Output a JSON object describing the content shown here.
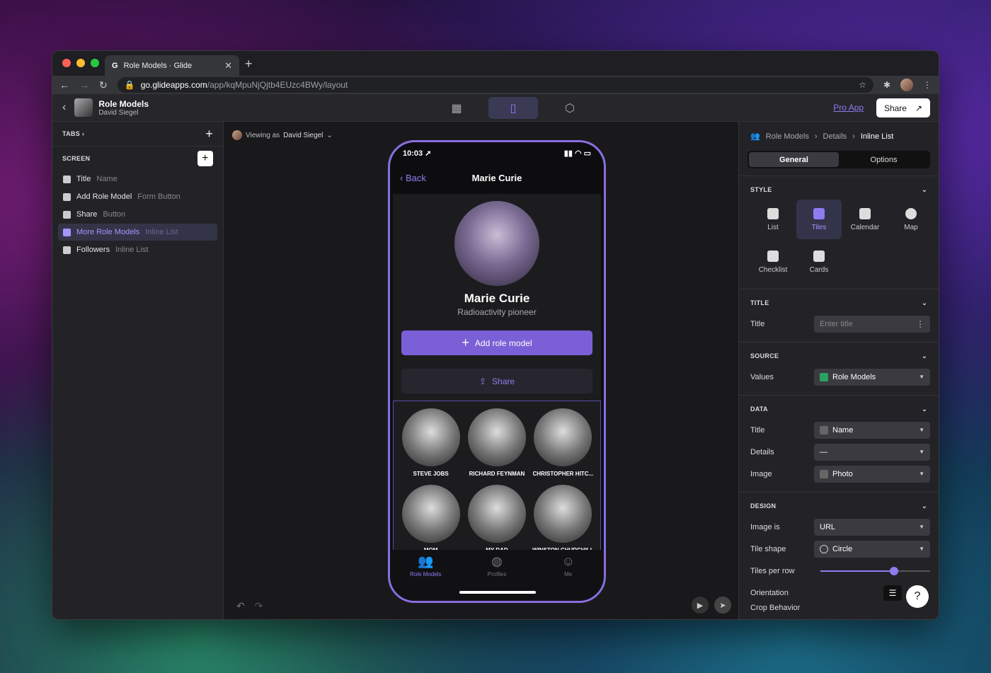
{
  "browser": {
    "tab_favicon": "G",
    "tab_title": "Role Models · Glide",
    "url_host": "go.glideapps.com",
    "url_path": "/app/kqMpuNjQjtb4EUzc4BWy/layout"
  },
  "header": {
    "app_title": "Role Models",
    "app_subtitle": "David Siegel",
    "pro_app": "Pro App",
    "share": "Share"
  },
  "left": {
    "tabs_label": "TABS",
    "screen_label": "SCREEN",
    "components": [
      {
        "name": "Title",
        "type": "Name"
      },
      {
        "name": "Add Role Model",
        "type": "Form Button"
      },
      {
        "name": "Share",
        "type": "Button"
      },
      {
        "name": "More Role Models",
        "type": "Inline List"
      },
      {
        "name": "Followers",
        "type": "Inline List"
      }
    ]
  },
  "canvas": {
    "viewing_prefix": "Viewing as",
    "viewing_user": "David Siegel"
  },
  "phone": {
    "time": "10:03",
    "back": "Back",
    "nav_title": "Marie Curie",
    "name": "Marie Curie",
    "subtitle": "Radioactivity pioneer",
    "add_button": "Add role model",
    "share_button": "Share",
    "tiles": [
      "STEVE JOBS",
      "RICHARD FEYNMAN",
      "CHRISTOPHER HITC...",
      "MOM",
      "MY DAD",
      "WINSTON CHURCHILL"
    ],
    "tabs": [
      {
        "label": "Role Models",
        "icon": "people-icon"
      },
      {
        "label": "Profiles",
        "icon": "globe-icon"
      },
      {
        "label": "Me",
        "icon": "smiley-icon"
      }
    ]
  },
  "right": {
    "crumbs": [
      "Role Models",
      "Details",
      "Inline List"
    ],
    "seg": [
      "General",
      "Options"
    ],
    "style_title": "STYLE",
    "styles": [
      "List",
      "Tiles",
      "Calendar",
      "Map",
      "Checklist",
      "Cards"
    ],
    "title_section": "TITLE",
    "title_label": "Title",
    "title_placeholder": "Enter title",
    "source_section": "SOURCE",
    "values_label": "Values",
    "values_value": "Role Models",
    "data_section": "DATA",
    "data_title_label": "Title",
    "data_title_value": "Name",
    "details_label": "Details",
    "details_value": "—",
    "image_label": "Image",
    "image_value": "Photo",
    "design_section": "DESIGN",
    "image_is_label": "Image is",
    "image_is_value": "URL",
    "tile_shape_label": "Tile shape",
    "tile_shape_value": "Circle",
    "tiles_per_row_label": "Tiles per row",
    "tiles_per_row_fraction": 0.67,
    "orientation_label": "Orientation",
    "crop_label": "Crop Behavior"
  },
  "colors": {
    "accent": "#8e7cf0",
    "primary_button": "#7a5fd6"
  }
}
